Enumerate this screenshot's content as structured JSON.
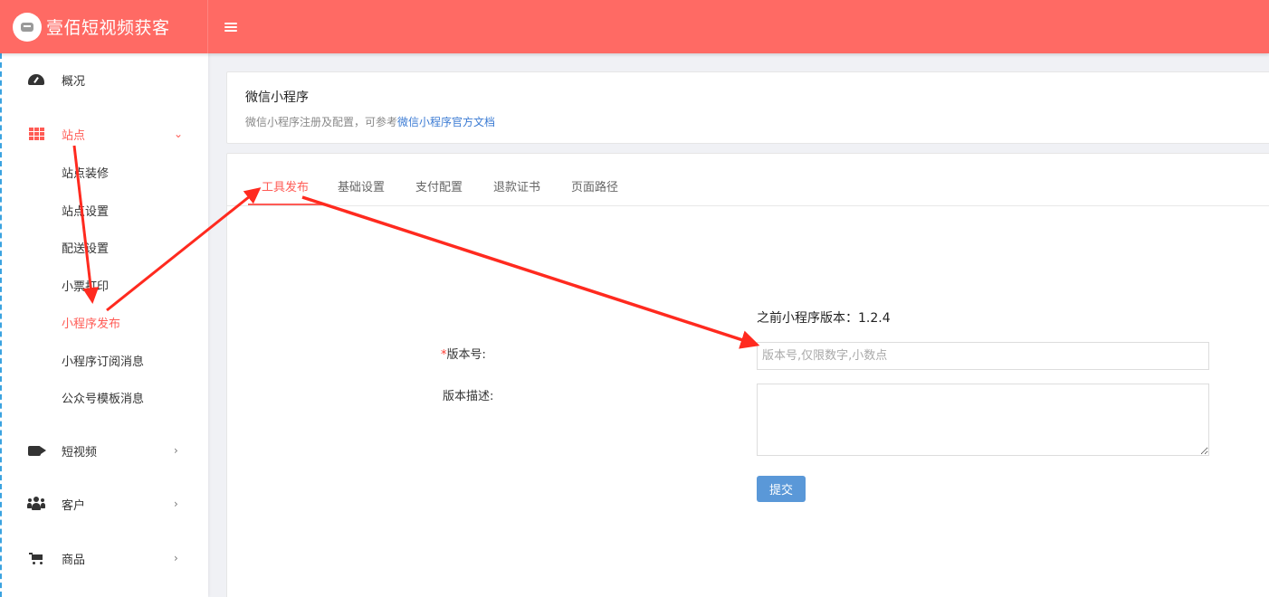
{
  "header": {
    "app_title": "壹佰短视频获客",
    "logo_icon": "video-logo-icon",
    "menu_icon": "hamburger-icon",
    "bg_color": "#ff6a64"
  },
  "sidebar": {
    "items": [
      {
        "label": "概况",
        "icon": "dashboard-icon"
      },
      {
        "label": "站点",
        "icon": "grid-icon",
        "expanded": true,
        "active": true,
        "children": [
          "站点装修",
          "站点设置",
          "配送设置",
          "小票打印",
          "小程序发布",
          "小程序订阅消息",
          "公众号模板消息"
        ],
        "active_child": "小程序发布"
      },
      {
        "label": "短视频",
        "icon": "video-camera-icon"
      },
      {
        "label": "客户",
        "icon": "users-icon"
      },
      {
        "label": "商品",
        "icon": "cart-icon"
      }
    ],
    "accent_color": "#ff5b55"
  },
  "page_header": {
    "title": "微信小程序",
    "desc_prefix": "微信小程序注册及配置，可参考",
    "desc_link": "微信小程序官方文档"
  },
  "tabs": {
    "items": [
      "工具发布",
      "基础设置",
      "支付配置",
      "退款证书",
      "页面路径"
    ],
    "active": "工具发布"
  },
  "form": {
    "prev_version_text": "之前小程序版本：1.2.4",
    "version_label_required": "*",
    "version_label": "版本号:",
    "version_value": "",
    "version_placeholder": "版本号,仅限数字,小数点",
    "desc_label": "版本描述:",
    "desc_value": "",
    "submit_label": "提交",
    "submit_color": "#5a98d8"
  },
  "annotation": {
    "arrow_color": "#ff2a1f"
  }
}
